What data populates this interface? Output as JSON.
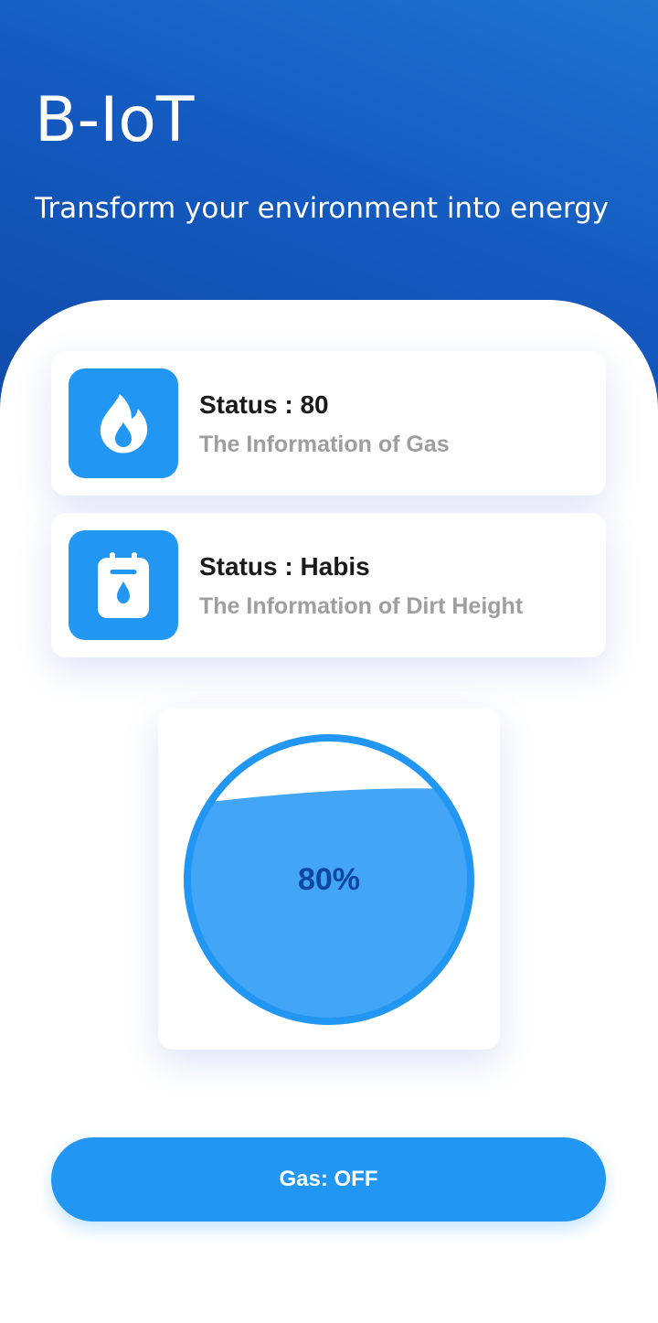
{
  "header": {
    "title": "B-IoT",
    "subtitle": "Transform your environment into energy"
  },
  "cards": [
    {
      "status": "Status : 80",
      "description": "The Information of Gas",
      "icon": "flame-icon"
    },
    {
      "status": "Status : Habis",
      "description": "The Information of Dirt Height",
      "icon": "water-tank-icon"
    }
  ],
  "gauge": {
    "label": "80%",
    "value": 0.8
  },
  "button": {
    "label": "Gas: OFF"
  },
  "colors": {
    "accent": "#2196f3",
    "header_dark": "#0f4aa8",
    "gauge_fill": "#42a5f5",
    "gauge_text": "#0d47a1"
  }
}
